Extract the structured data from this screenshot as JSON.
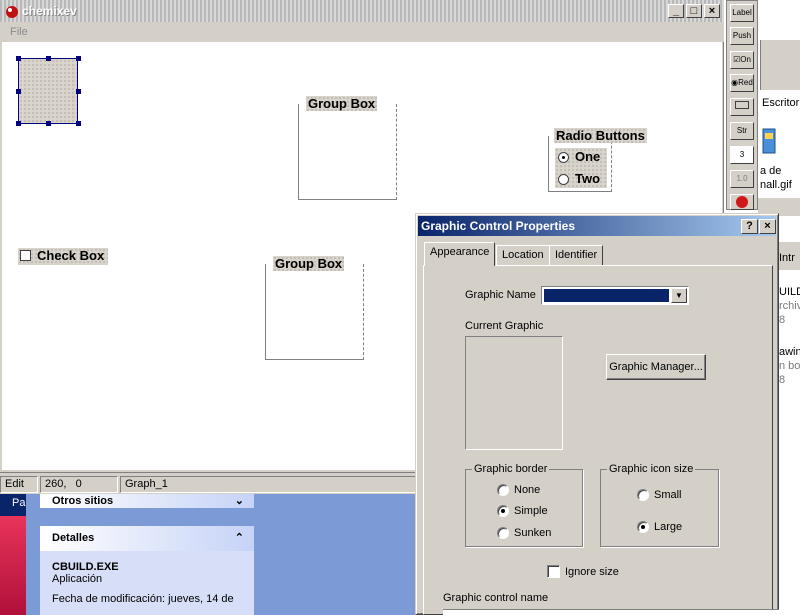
{
  "designer": {
    "title": "chemixev",
    "menu": [
      "File"
    ],
    "buttons": {
      "minimize": "_",
      "maximize": "□",
      "close": "×"
    },
    "controls": {
      "group_box_1": "Group Box",
      "group_box_2": "Group Box",
      "radio_title": "Radio Buttons",
      "radio_one": "One",
      "radio_two": "Two",
      "check_box": "Check Box"
    },
    "status": {
      "mode": "Edit",
      "coords": "260,   0",
      "name": "Graph_1"
    }
  },
  "toolbox": {
    "items": [
      "Label",
      "Push",
      "On",
      "Red",
      "",
      "Str",
      "3",
      "1.0",
      ""
    ]
  },
  "background": {
    "right_texts": {
      "escritorio": "Escritori",
      "file_a": "a de",
      "file_b": "nall.gif",
      "intro": "Intr",
      "ild": "UILD",
      "nivo": "rchivo",
      "num_a": "8",
      "wing": "awing",
      "bod": "n bod",
      "num_b": "8"
    },
    "task_label": "Pa",
    "panels": {
      "otros": "Otros sitios",
      "detalles": "Detalles",
      "file_name": "CBUILD.EXE",
      "file_type": "Aplicación",
      "file_date": "Fecha de modificación: jueves, 14 de"
    }
  },
  "dialog": {
    "title": "Graphic Control Properties",
    "help": "?",
    "close": "×",
    "tabs": [
      "Appearance",
      "Location",
      "Identifier"
    ],
    "graphic_name_label": "Graphic Name",
    "graphic_name_value": "",
    "current_graphic_label": "Current Graphic",
    "graphic_manager": "Graphic Manager...",
    "border": {
      "legend": "Graphic border",
      "options": [
        "None",
        "Simple",
        "Sunken"
      ],
      "selected": "Simple"
    },
    "icon_size": {
      "legend": "Graphic icon size",
      "options": [
        "Small",
        "Large"
      ],
      "selected": "Large"
    },
    "ignore_size": "Ignore size",
    "control_name_label": "Graphic control name"
  }
}
